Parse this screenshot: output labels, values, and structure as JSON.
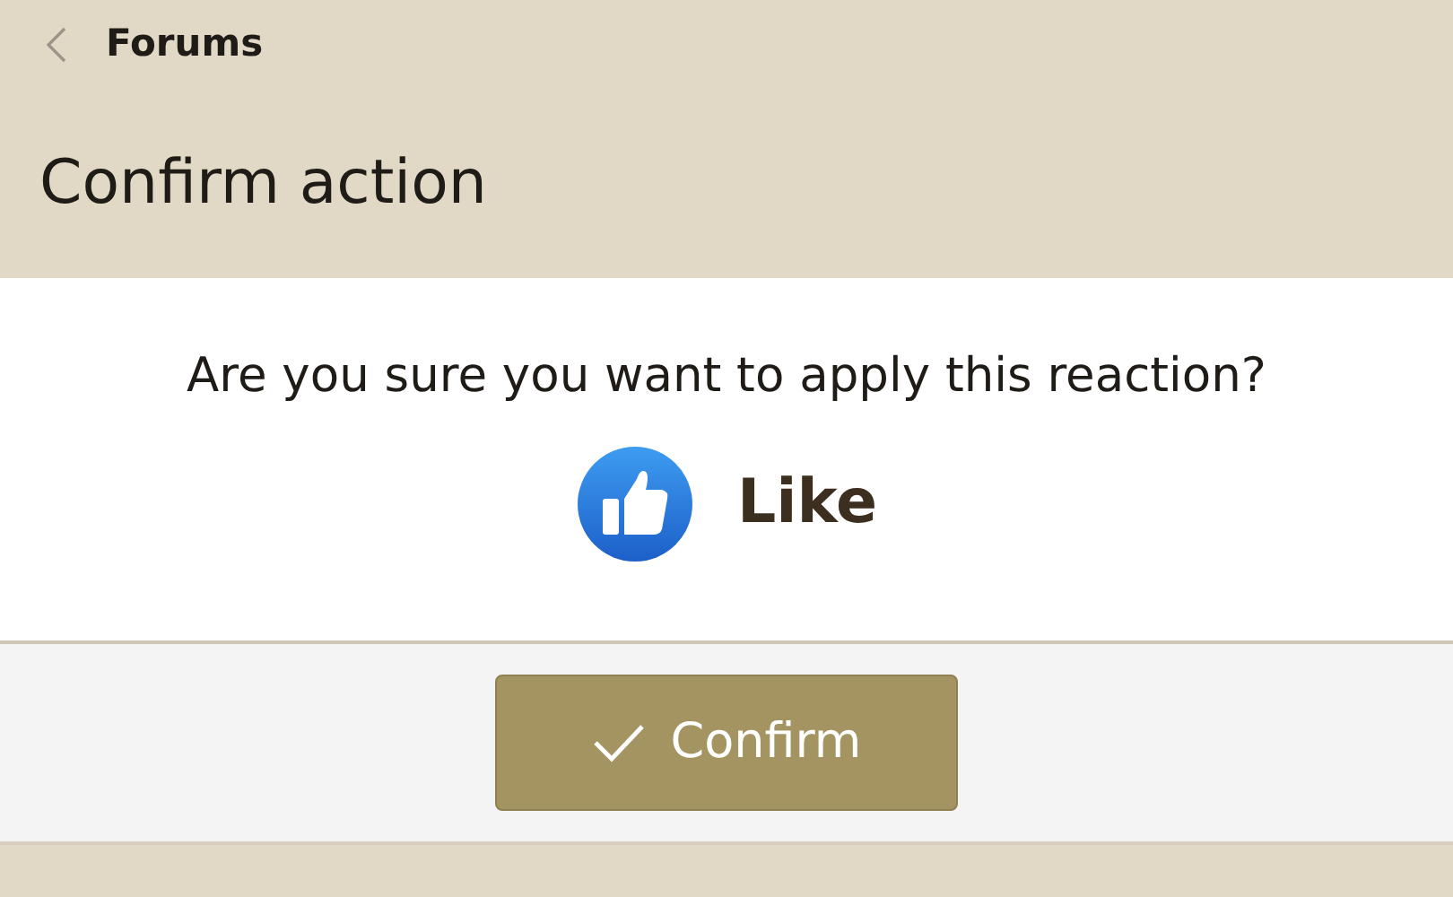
{
  "nav": {
    "back_label": "Forums"
  },
  "title": "Confirm action",
  "message": "Are you sure you want to apply this reaction?",
  "reaction": {
    "label": "Like"
  },
  "buttons": [
    {
      "label": "Confirm",
      "kind": "confirm"
    }
  ]
}
